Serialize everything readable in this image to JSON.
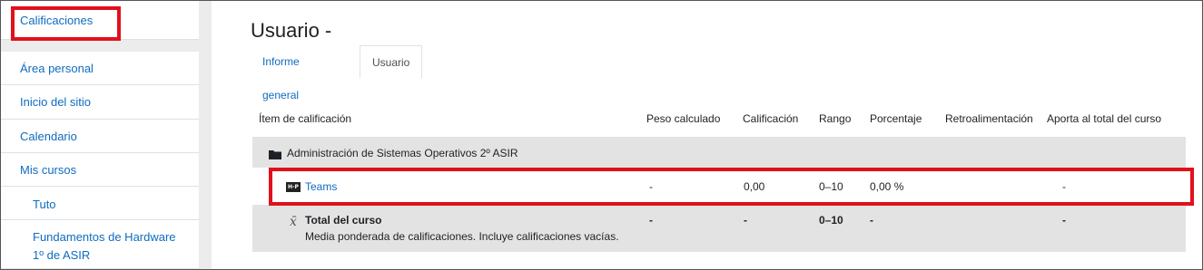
{
  "sidebar": {
    "title": "Calificaciones",
    "items": [
      {
        "label": "Área personal"
      },
      {
        "label": "Inicio del sitio"
      },
      {
        "label": "Calendario"
      },
      {
        "label": "Mis cursos"
      },
      {
        "label": "Tuto"
      },
      {
        "label": "Fundamentos de Hardware 1º de ASIR"
      }
    ]
  },
  "page": {
    "title": "Usuario -"
  },
  "tabs": [
    {
      "label": "Informe general"
    },
    {
      "label": "Usuario"
    }
  ],
  "table": {
    "headers": [
      "Ítem de calificación",
      "Peso calculado",
      "Calificación",
      "Rango",
      "Porcentaje",
      "Retroalimentación",
      "Aporta al total del curso"
    ],
    "category": {
      "name": "Administración de Sistemas Operativos 2º ASIR",
      "icon": "folder-icon"
    },
    "item": {
      "name": "Teams",
      "icon": "h5p-icon",
      "icon_text": "H-P",
      "weight": "-",
      "grade": "0,00",
      "range": "0–10",
      "percentage": "0,00 %",
      "feedback": "",
      "contribution": "-"
    },
    "total": {
      "symbol": "x̄",
      "name": "Total del curso",
      "description": "Media ponderada de calificaciones. Incluye calificaciones vacías.",
      "weight": "-",
      "grade": "-",
      "range": "0–10",
      "percentage": "-",
      "contribution": "-"
    }
  },
  "colors": {
    "link": "#0f6cbf",
    "highlight": "#e0111b",
    "row_shade": "#e3e3e3"
  }
}
